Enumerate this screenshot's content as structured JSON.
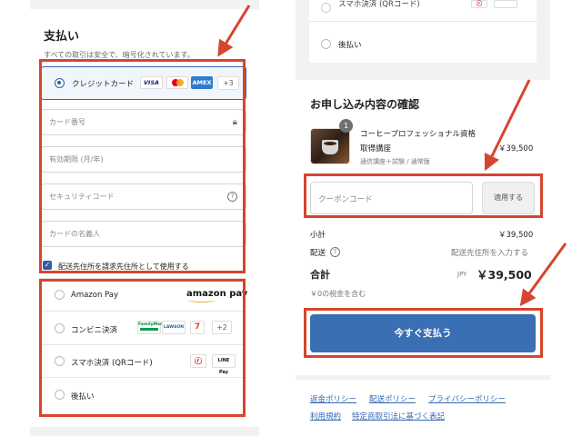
{
  "payment": {
    "title": "支払い",
    "subtitle": "すべての取引は安全で、暗号化されています。",
    "credit_card": {
      "label": "クレジットカード",
      "brands": [
        "VISA",
        "AMEX"
      ],
      "more": "+3"
    },
    "fields": {
      "card_number": "カード番号",
      "expiry": "有効期限 (月/年)",
      "security_code": "セキュリティコード",
      "card_name": "カードの名義人"
    },
    "billing_same_label": "配送先住所を請求先住所として使用する",
    "methods": {
      "amazon_pay": "Amazon Pay",
      "amazon_logo": "amazon pay",
      "convenience": "コンビニ決済",
      "convenience_more": "+2",
      "convenience_brands": [
        "FamilyMart",
        "LAWSON"
      ],
      "mobile": "スマホ決済 (QRコード)",
      "mobile_brand": "LINE Pay",
      "deferred": "後払い"
    }
  },
  "right_top": {
    "truncated_label": "スマホ決済 (QRコード)",
    "deferred": "後払い"
  },
  "order": {
    "title": "お申し込み内容の確認",
    "quantity": "1",
    "product_name_line1": "コーヒープロフェッショナル資格",
    "product_name_line2": "取得講座",
    "product_variant": "通信講座＋試験 / 通常版",
    "product_price": "￥39,500",
    "coupon_placeholder": "クーポンコード",
    "coupon_button": "適用する",
    "subtotal_label": "小計",
    "subtotal_value": "￥39,500",
    "shipping_label": "配送",
    "shipping_value": "配送先住所を入力する",
    "total_label": "合計",
    "currency": "JPY",
    "total_value": "￥39,500",
    "tax_note": "￥0の税金を含む",
    "pay_button": "今すぐ支払う"
  },
  "footer": {
    "refund_policy": "返金ポリシー",
    "shipping_policy": "配送ポリシー",
    "privacy_policy": "プライバシーポリシー",
    "terms": "利用規約",
    "commerce_law": "特定商取引法に基づく表記"
  },
  "colors": {
    "accent": "#3a6fb3",
    "annotation": "#d6452d"
  }
}
